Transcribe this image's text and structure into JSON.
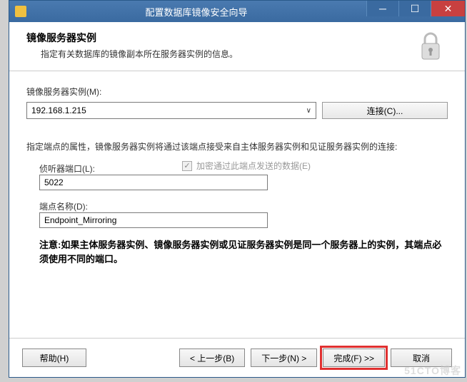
{
  "titlebar": {
    "title": "配置数据库镜像安全向导"
  },
  "header": {
    "title": "镜像服务器实例",
    "subtitle": "指定有关数据库的镜像副本所在服务器实例的信息。"
  },
  "server": {
    "label": "镜像服务器实例(M):",
    "value": "192.168.1.215",
    "connect_label": "连接(C)..."
  },
  "endpoint": {
    "description": "指定端点的属性，镜像服务器实例将通过该端点接受来自主体服务器实例和见证服务器实例的连接:",
    "port_label": "侦听器端口(L):",
    "port_value": "5022",
    "encrypt_label": "加密通过此端点发送的数据(E)",
    "name_label": "端点名称(D):",
    "name_value": "Endpoint_Mirroring"
  },
  "note": "注意:如果主体服务器实例、镜像服务器实例或见证服务器实例是同一个服务器上的实例，其端点必须使用不同的端口。",
  "footer": {
    "help": "帮助(H)",
    "back": "< 上一步(B)",
    "next": "下一步(N) >",
    "finish": "完成(F) >>",
    "cancel": "取消"
  },
  "watermark": "51CTO博客"
}
